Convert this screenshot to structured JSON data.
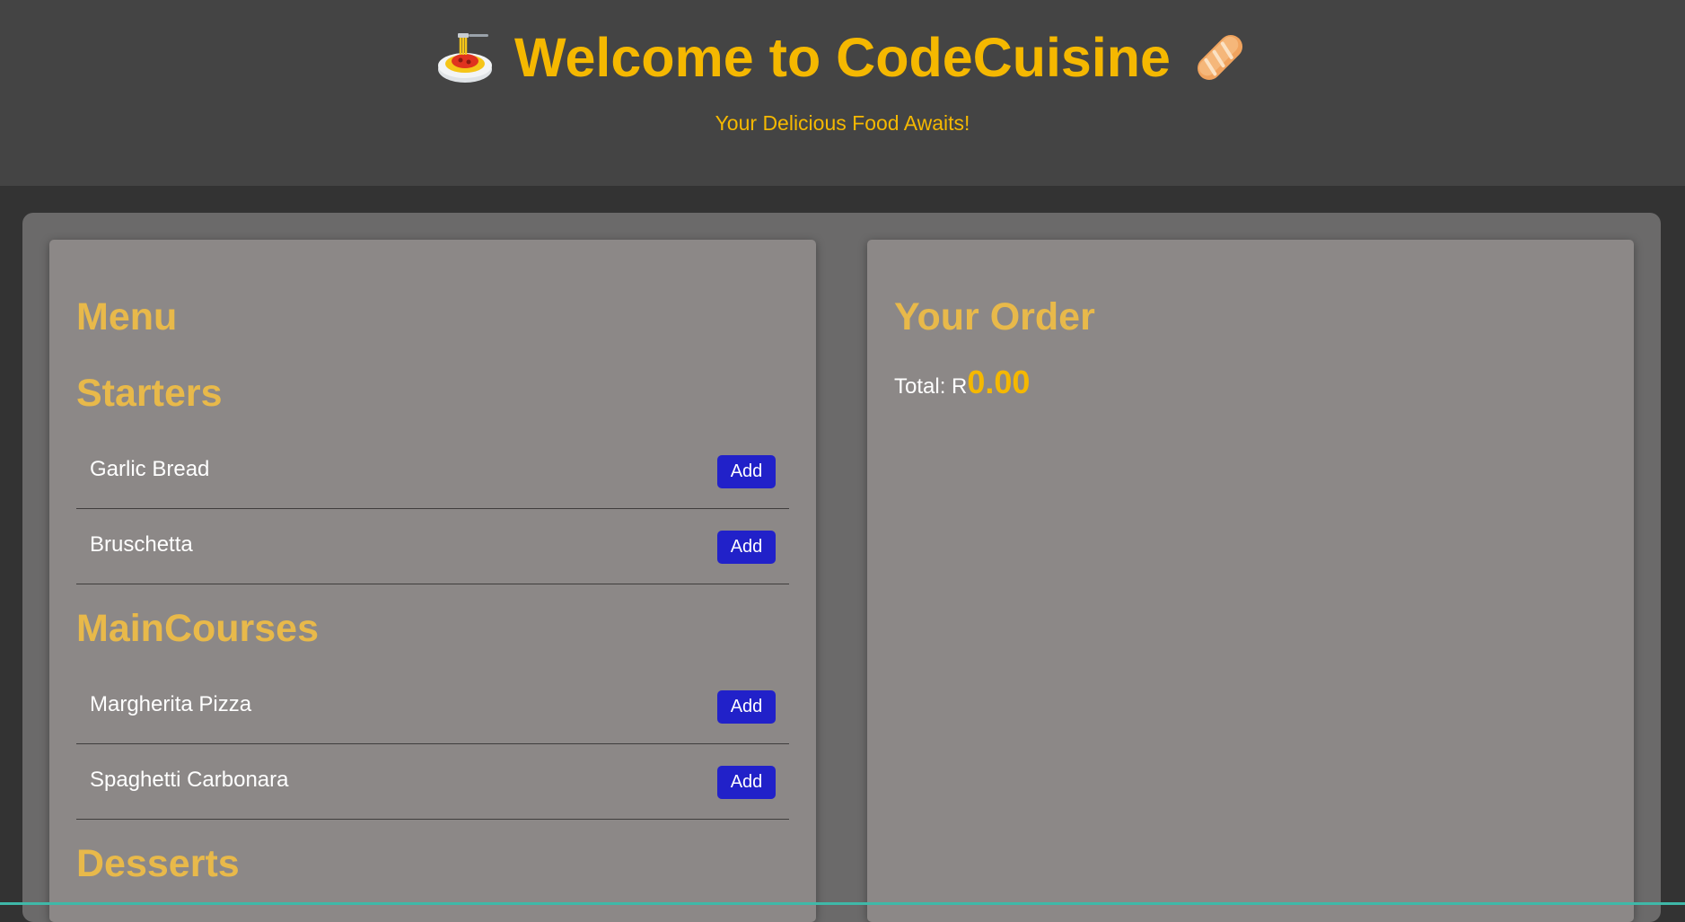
{
  "header": {
    "title": "Welcome to CodeCuisine",
    "subtitle": "Your Delicious Food Awaits!",
    "left_icon": "spaghetti-icon",
    "right_icon": "bread-icon"
  },
  "menu": {
    "title": "Menu",
    "categories": [
      {
        "name": "Starters",
        "items": [
          {
            "name": "Garlic Bread",
            "button": "Add"
          },
          {
            "name": "Bruschetta",
            "button": "Add"
          }
        ]
      },
      {
        "name": "MainCourses",
        "items": [
          {
            "name": "Margherita Pizza",
            "button": "Add"
          },
          {
            "name": "Spaghetti Carbonara",
            "button": "Add"
          }
        ]
      },
      {
        "name": "Desserts",
        "items": []
      }
    ]
  },
  "order": {
    "title": "Your Order",
    "total_label": "Total: R",
    "total_value": "0.00"
  },
  "colors": {
    "accent": "#f5b800",
    "heading": "#e8b94a",
    "button": "#2121c9",
    "header_bg": "#444444",
    "page_bg": "#333333",
    "panel_bg": "#8c8887"
  }
}
